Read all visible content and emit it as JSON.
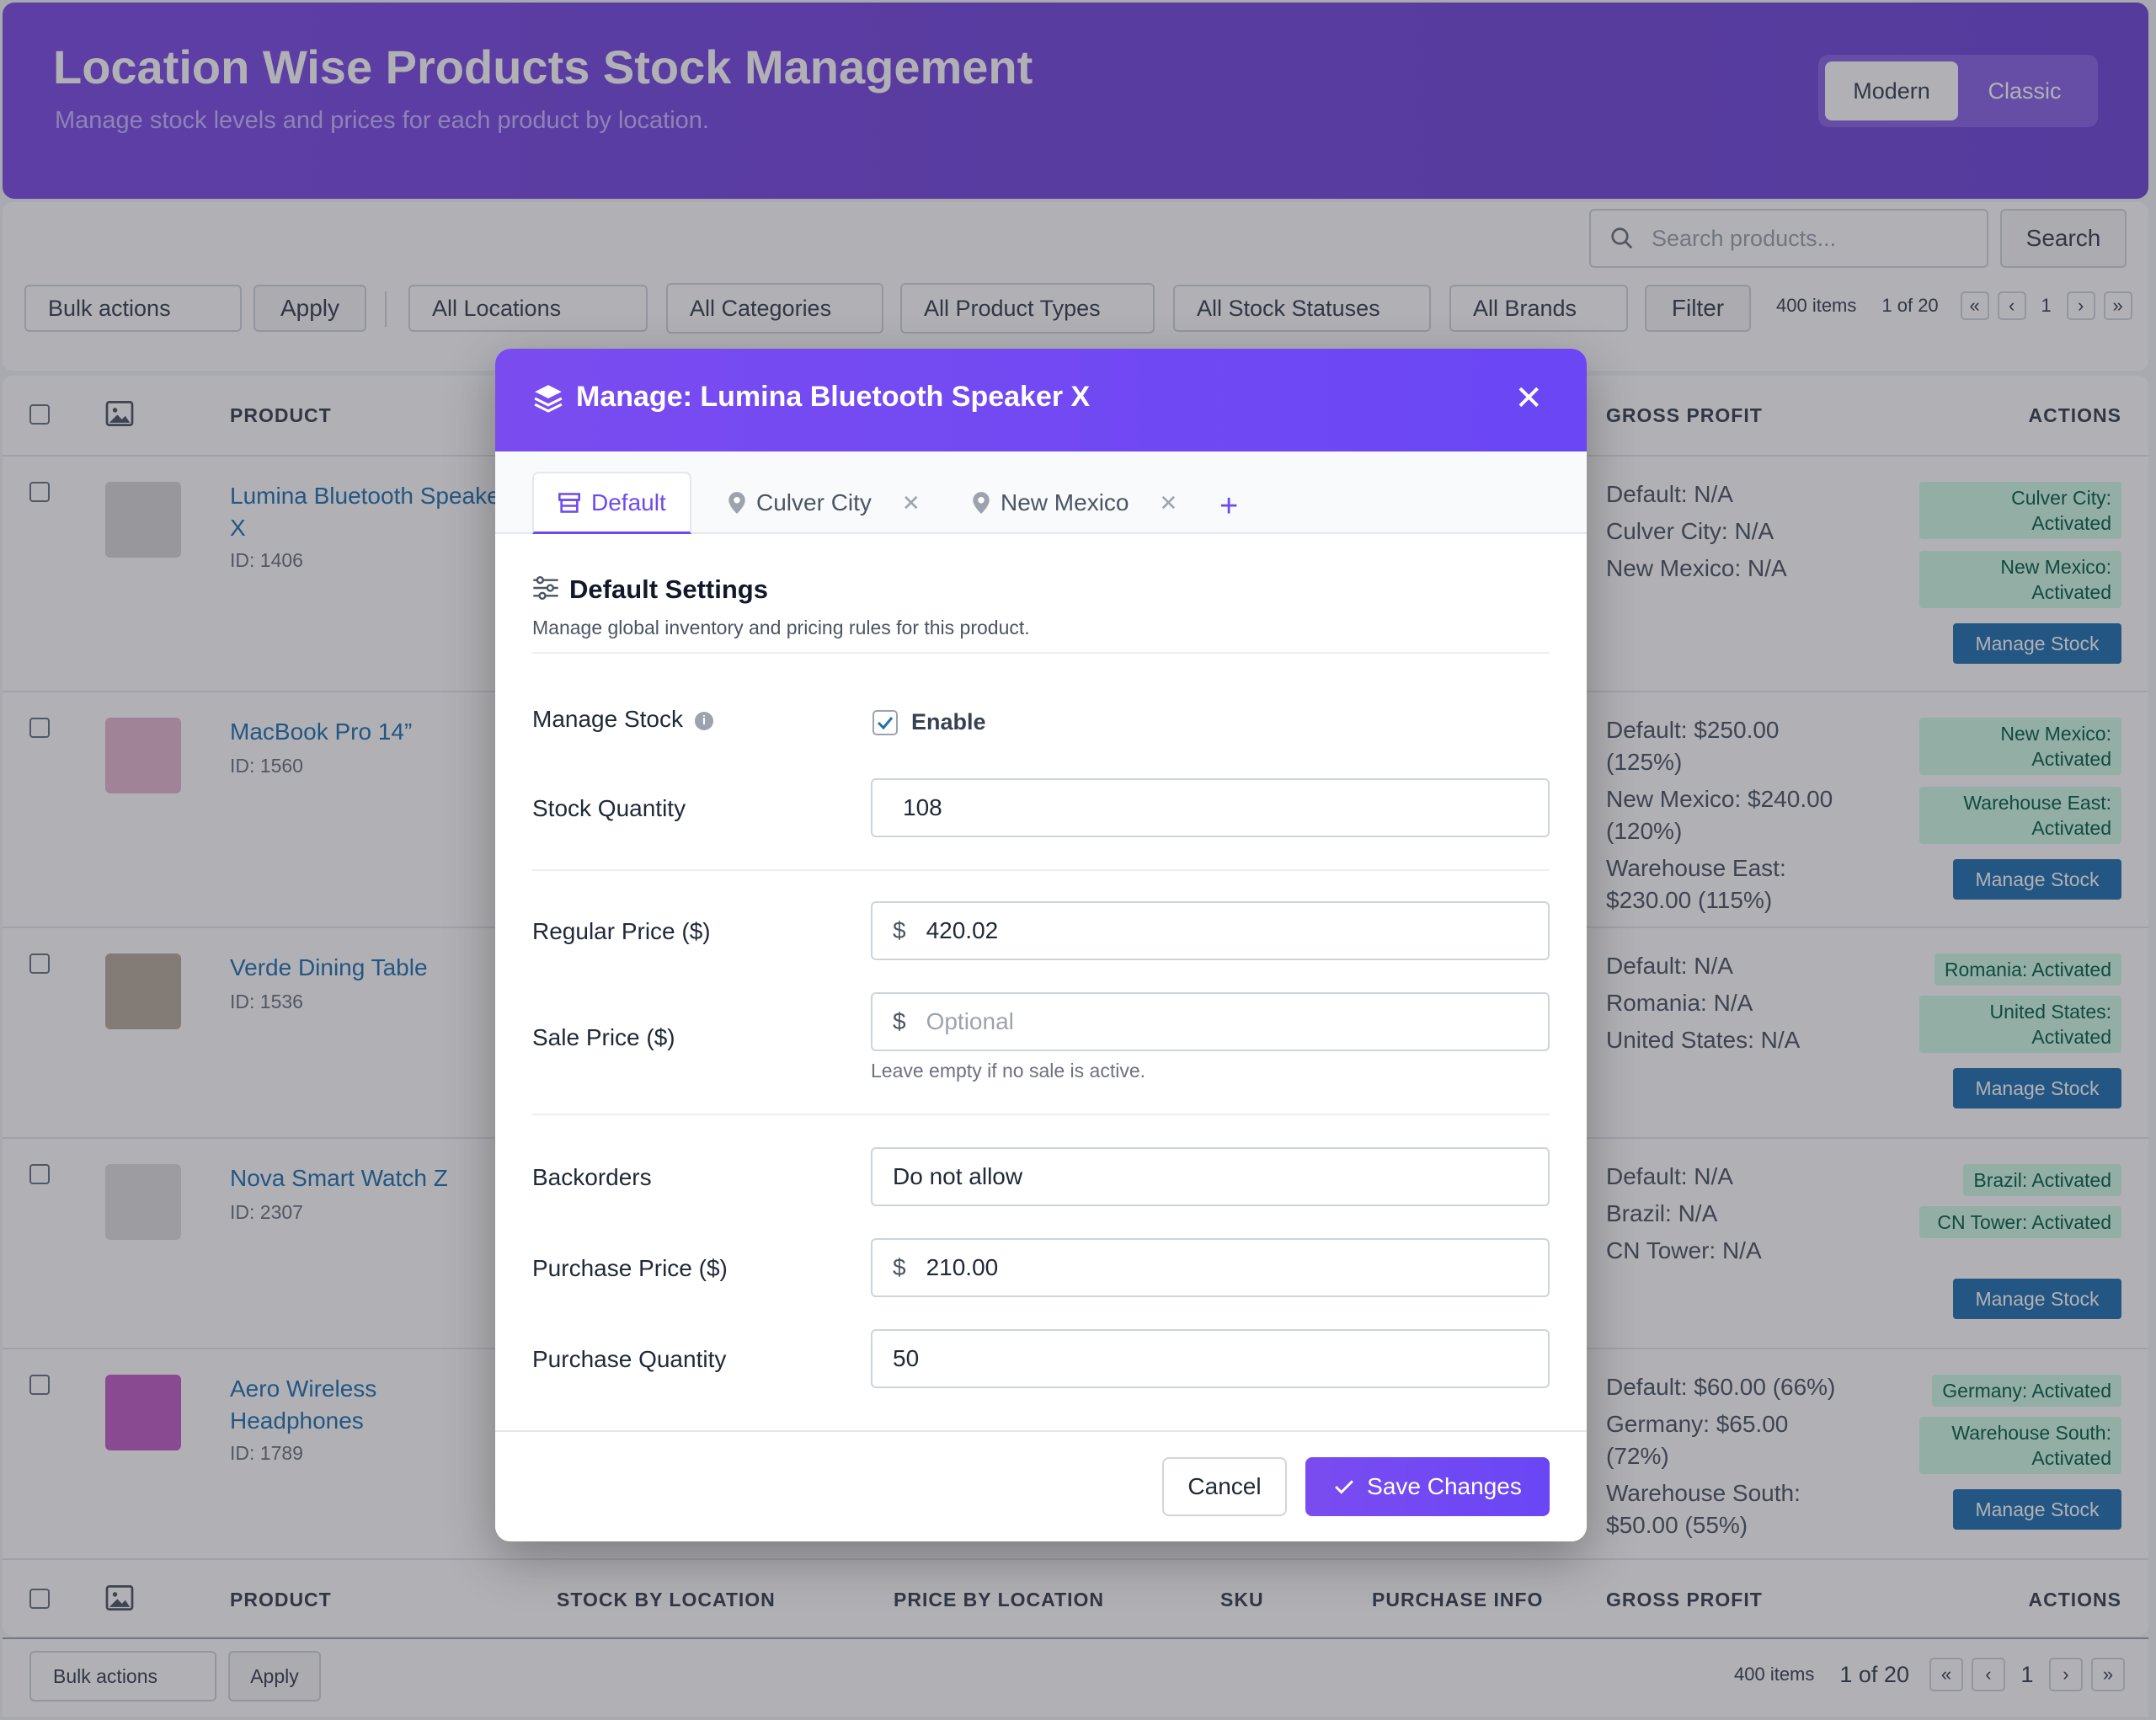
{
  "header": {
    "title": "Location Wise Products Stock Management",
    "subtitle": "Manage stock levels and prices for each product by location.",
    "view_modern": "Modern",
    "view_classic": "Classic"
  },
  "toolbar": {
    "search_placeholder": "Search products...",
    "search_button": "Search",
    "bulk_actions": "Bulk actions",
    "apply": "Apply",
    "locations": "All Locations",
    "categories": "All Categories",
    "product_types": "All Product Types",
    "stock_statuses": "All Stock Statuses",
    "brands": "All Brands",
    "filter": "Filter",
    "items": "400 items",
    "page_of": "1 of 20",
    "page": "1"
  },
  "table": {
    "headers": {
      "product": "PRODUCT",
      "stock_by_location": "STOCK BY LOCATION",
      "price_by_location": "PRICE BY LOCATION",
      "sku": "SKU",
      "purchase_info": "PURCHASE INFO",
      "gross_profit": "GROSS PROFIT",
      "actions": "ACTIONS"
    },
    "manage_stock_label": "Manage Stock",
    "rows": [
      {
        "name": "Lumina Bluetooth Speaker X",
        "id": "ID: 1406",
        "gross_profit": [
          "Default: N/A",
          "Culver City: N/A",
          "New Mexico: N/A"
        ],
        "badges": [
          "Culver City: Activated",
          "New Mexico: Activated"
        ]
      },
      {
        "name": "MacBook Pro 14”",
        "id": "ID: 1560",
        "gross_profit": [
          "Default: $250.00 (125%)",
          "New Mexico: $240.00 (120%)",
          "Warehouse East: $230.00 (115%)"
        ],
        "badges": [
          "New Mexico: Activated",
          "Warehouse East: Activated"
        ]
      },
      {
        "name": "Verde Dining Table",
        "id": "ID: 1536",
        "gross_profit": [
          "Default: N/A",
          "Romania: N/A",
          "United States: N/A"
        ],
        "badges": [
          "Romania: Activated",
          "United States: Activated"
        ]
      },
      {
        "name": "Nova Smart Watch Z",
        "id": "ID: 2307",
        "gross_profit": [
          "Default: N/A",
          "Brazil: N/A",
          "CN Tower: N/A"
        ],
        "badges": [
          "Brazil: Activated",
          "CN Tower: Activated"
        ]
      },
      {
        "name": "Aero Wireless Headphones",
        "id": "ID: 1789",
        "gross_profit": [
          "Default: $60.00 (66%)",
          "Germany: $65.00 (72%)",
          "Warehouse South: $50.00 (55%)"
        ],
        "badges": [
          "Germany: Activated",
          "Warehouse South: Activated"
        ]
      }
    ]
  },
  "footer": {
    "bulk_actions": "Bulk actions",
    "apply": "Apply",
    "items": "400 items",
    "page_of": "1 of 20",
    "page": "1"
  },
  "modal": {
    "title": "Manage: Lumina Bluetooth Speaker X",
    "tabs": [
      "Default",
      "Culver City",
      "New Mexico"
    ],
    "section_title": "Default Settings",
    "section_desc": "Manage global inventory and pricing rules for this product.",
    "fields": {
      "manage_stock_label": "Manage Stock",
      "enable_label": "Enable",
      "stock_qty_label": "Stock Quantity",
      "stock_qty_value": "108",
      "regular_price_label": "Regular Price ($)",
      "regular_price_value": "420.02",
      "sale_price_label": "Sale Price ($)",
      "sale_price_placeholder": "Optional",
      "sale_hint": "Leave empty if no sale is active.",
      "backorders_label": "Backorders",
      "backorders_value": "Do not allow",
      "purchase_price_label": "Purchase Price ($)",
      "purchase_price_value": "210.00",
      "purchase_qty_label": "Purchase Quantity",
      "purchase_qty_value": "50",
      "currency": "$"
    },
    "cancel": "Cancel",
    "save": "Save Changes"
  },
  "colors": {
    "accent": "#6d4aed",
    "link": "#2271b1",
    "badge_bg": "#d1fae5",
    "badge_text": "#065f46"
  }
}
